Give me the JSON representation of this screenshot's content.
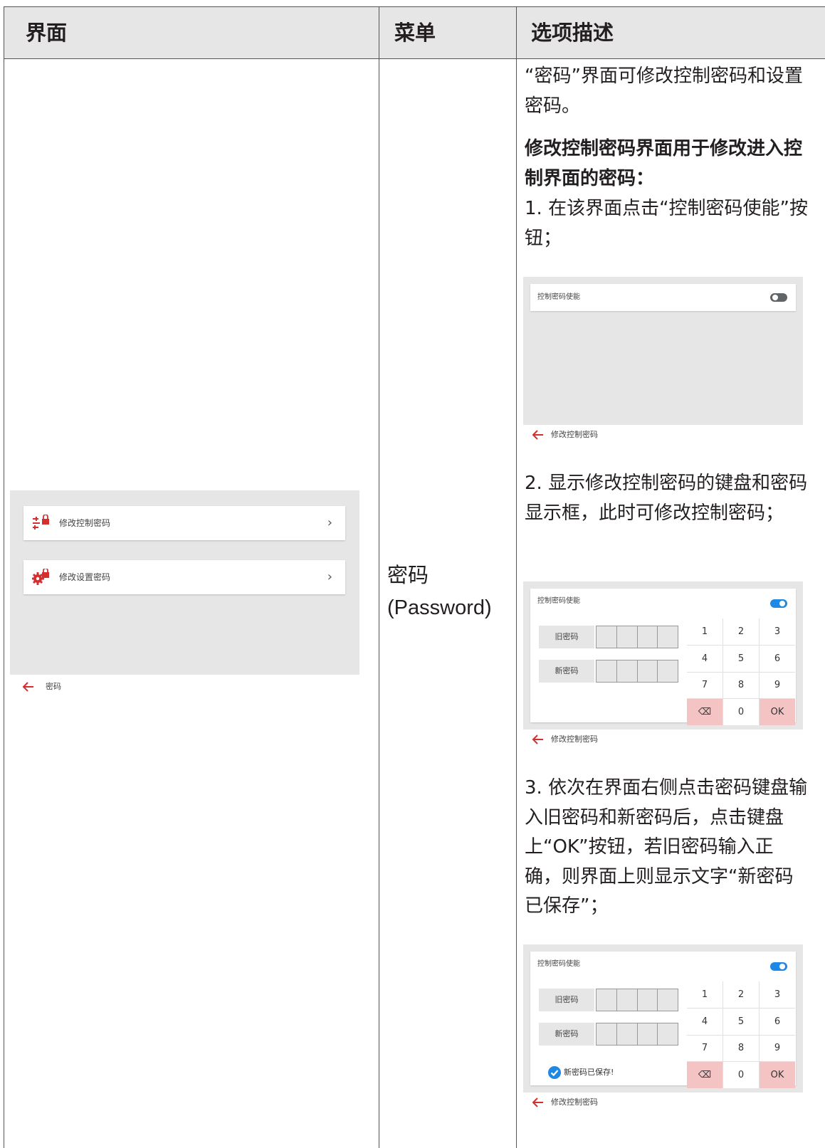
{
  "header": {
    "col1": "界面",
    "col2": "菜单",
    "col3": "选项描述"
  },
  "menu": {
    "name": "密码",
    "name_en": "(Password)"
  },
  "left_screen": {
    "items": [
      {
        "label": "修改控制密码",
        "icon": "sliders-lock-icon"
      },
      {
        "label": "修改设置密码",
        "icon": "gear-lock-icon"
      }
    ],
    "back_label": "密码"
  },
  "desc": {
    "intro": "“密码”界面可修改控制密码和设置密码。",
    "heading": "修改控制密码界面用于修改进入控制界面的密码：",
    "step1": "1. 在该界面点击“控制密码使能”按钮；",
    "step2": "2. 显示修改控制密码的键盘和密码显示框，此时可修改控制密码；",
    "step3": "3. 依次在界面右侧点击密码键盘输入旧密码和新密码后，点击键盘上“OK”按钮，若旧密码输入正确，则界面上则显示文字“新密码已保存”；"
  },
  "screens": {
    "toggle_label": "控制密码使能",
    "back_label": "修改控制密码",
    "old_pw_label": "旧密码",
    "new_pw_label": "新密码",
    "keys": [
      "1",
      "2",
      "3",
      "4",
      "5",
      "6",
      "7",
      "8",
      "9",
      "⌫",
      "0",
      "OK"
    ],
    "saved_msg": "新密码已保存!"
  },
  "colors": {
    "accent_red": "#d32f2f",
    "toggle_on": "#1e88e5",
    "toggle_off": "#606468",
    "key_pink": "#f4c4c4",
    "panel_grey": "#e6e6e6"
  }
}
